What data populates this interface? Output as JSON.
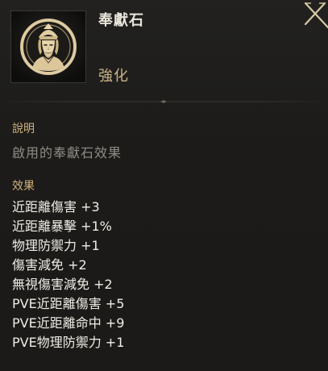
{
  "item": {
    "name": "奉獻石",
    "grade": "強化",
    "icon": "golden-warrior-portrait-icon"
  },
  "close": {
    "icon": "close-x-icon"
  },
  "description": {
    "label": "說明",
    "text": "啟用的奉獻石效果"
  },
  "effects": {
    "label": "效果",
    "items": [
      "近距離傷害 +3",
      "近距離暴擊 +1%",
      "物理防禦力 +1",
      "傷害減免 +2",
      "無視傷害減免 +2",
      "PVE近距離傷害 +5",
      "PVE近距離命中 +9",
      "PVE物理防禦力 +1"
    ]
  },
  "colors": {
    "background": "#1c1b19",
    "section_label": "#cfb27d",
    "grade": "#c9b48a",
    "description": "#8f8c86",
    "effect_text": "#efece5",
    "icon_gold": "#d8c49a"
  }
}
